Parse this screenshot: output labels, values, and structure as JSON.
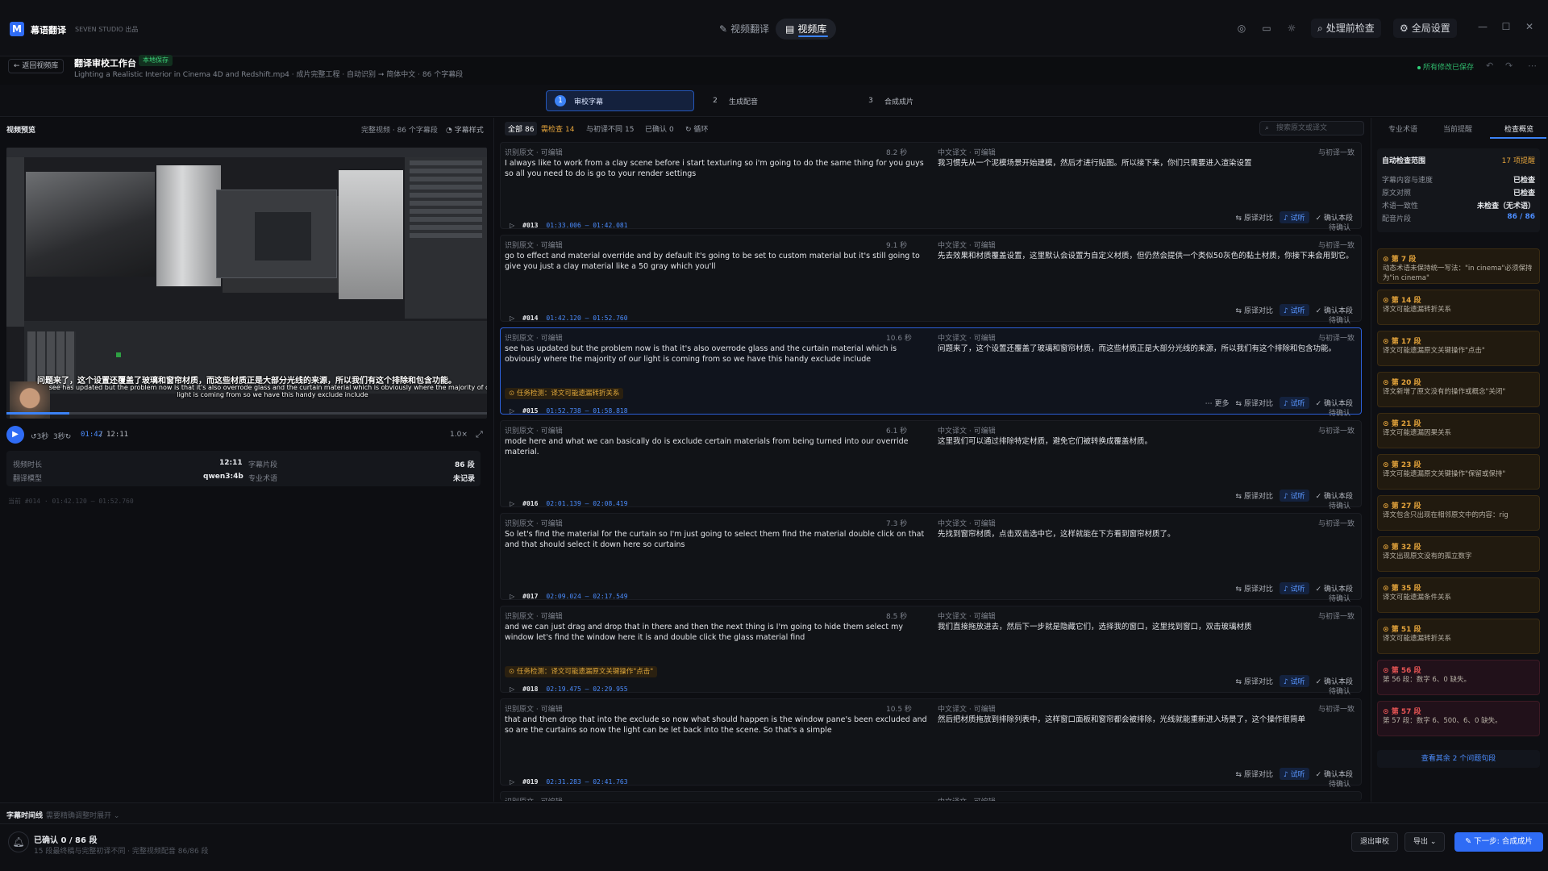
{
  "app": {
    "name": "幕语翻译",
    "subtitle": "SEVEN STUDIO 出品",
    "logo": "M"
  },
  "nav": {
    "tabs": [
      {
        "icon": "translate-icon",
        "label": "视频翻译"
      },
      {
        "icon": "library-icon",
        "label": "视频库"
      }
    ]
  },
  "toolbar": {
    "precheck": "处理前检查",
    "settings": "全局设置"
  },
  "subheader": {
    "back": "返回视频库",
    "title": "翻译审校工作台",
    "badge": "本地保存",
    "file_line": "Lighting a Realistic Interior in Cinema 4D and Redshift.mp4 · 成片完整工程 · 自动识别 ➞ 简体中文 · 86 个字幕段",
    "saved_status": "所有修改已保存"
  },
  "steps": [
    {
      "num": "1",
      "label": "审校字幕"
    },
    {
      "num": "2",
      "label": "生成配音"
    },
    {
      "num": "3",
      "label": "合成成片"
    }
  ],
  "preview": {
    "title": "视频预览",
    "meta": "完整视频 · 86 个字幕段",
    "style_btn": "字幕样式",
    "subtitle_zh": "问题来了，这个设置还覆盖了玻璃和窗帘材质，而这些材质正是大部分光线的来源，所以我们有这个排除和包含功能。",
    "subtitle_en": "see has updated but the problem now is that it's also overrode glass and the curtain material which is obviously where the majority of our light is coming from so we have this handy exclude include",
    "progress": 0.1307,
    "back3": "3秒",
    "fwd3": "3秒",
    "current_time": "01:42",
    "separator": "/",
    "total_time": "12:11",
    "speed": "1.0×"
  },
  "info": {
    "duration_label": "视频时长",
    "duration": "12:11",
    "segments_label": "字幕片段",
    "segments": "86 段",
    "model_label": "翻译模型",
    "model": "qwen3:4b",
    "terms_label": "专业术语",
    "terms": "未记录"
  },
  "current_seg": "当前 #014 · 01:42.120 – 01:52.760",
  "filters": [
    {
      "label": "全部",
      "count": "86",
      "state": "active"
    },
    {
      "label": "需检查",
      "count": "14",
      "state": "warn"
    },
    {
      "label": "与初译不同",
      "count": "15",
      "state": "normal"
    },
    {
      "label": "已确认",
      "count": "0",
      "state": "normal"
    },
    {
      "label": "循环",
      "count": "",
      "state": "normal"
    }
  ],
  "search_placeholder": "搜索原文或译文",
  "labels": {
    "src": "识别原文 · 可编辑",
    "tr": "中文译文 · 可编辑",
    "compare": "原译对比",
    "try": "试听",
    "confirm": "确认本段",
    "more": "更多"
  },
  "segments": [
    {
      "id": "",
      "time": "",
      "state": "",
      "dur": "8.2 秒",
      "flag": "与初译一致",
      "src": "I always like to work from a clay scene before i start texturing so i'm going to do the same thing for you guys so all you need to do is go to your render settings",
      "tr": "我习惯先从一个泥模场景开始建模，然后才进行贴图。所以接下来，你们只需要进入渲染设置",
      "warn": ""
    },
    {
      "id": "#013",
      "time": "01:33.006 – 01:42.081",
      "state": "待确认",
      "dur": "9.1 秒",
      "flag": "与初译一致",
      "src": "go to effect and material override and by default it's going to be set to custom material but it's still going to give you just a clay material like a 50 gray which you'll",
      "tr": "先去效果和材质覆盖设置，这里默认会设置为自定义材质，但仍然会提供一个类似50灰色的黏土材质，你接下来会用到它。",
      "warn": ""
    },
    {
      "id": "#014",
      "time": "01:42.120 – 01:52.760",
      "state": "待确认",
      "dur": "10.6 秒",
      "flag": "与初译一致",
      "src": "see has updated but the problem now is that it's also overrode glass and the curtain material which is obviously where the majority of our light is coming from so we have this handy exclude include",
      "tr": "问题来了，这个设置还覆盖了玻璃和窗帘材质，而这些材质正是大部分光线的来源，所以我们有这个排除和包含功能。",
      "warn": "任务检测：译文可能遗漏转折关系"
    },
    {
      "id": "#015",
      "time": "01:52.738 – 01:58.818",
      "state": "待确认",
      "dur": "6.1 秒",
      "flag": "与初译一致",
      "src": "mode here and what we can basically do is exclude certain materials from being turned into our override material.",
      "tr": "这里我们可以通过排除特定材质，避免它们被转换成覆盖材质。",
      "warn": ""
    },
    {
      "id": "#016",
      "time": "02:01.139 – 02:08.419",
      "state": "待确认",
      "dur": "7.3 秒",
      "flag": "与初译一致",
      "src": "So let's find the material for the curtain so I'm just going to select them find the material double click on that and that should select it down here so curtains",
      "tr": "先找到窗帘材质，点击双击选中它，这样就能在下方看到窗帘材质了。",
      "warn": ""
    },
    {
      "id": "#017",
      "time": "02:09.024 – 02:17.549",
      "state": "待确认",
      "dur": "8.5 秒",
      "flag": "与初译一致",
      "src": "and we can just drag and drop that in there and then the next thing is I'm going to hide them select my window let's find the window here it is and double click the glass material find",
      "tr": "我们直接拖放进去，然后下一步就是隐藏它们，选择我的窗口，这里找到窗口，双击玻璃材质",
      "warn": "任务检测：译文可能遗漏原文关键操作\"点击\""
    },
    {
      "id": "#018",
      "time": "02:19.475 – 02:29.955",
      "state": "待确认",
      "dur": "10.5 秒",
      "flag": "与初译一致",
      "src": "that and then drop that into the exclude so now what should happen is the window pane's been excluded and so are the curtains so now the light can be let back into the scene. So that's a simple",
      "tr": "然后把材质拖放到排除列表中，这样窗口面板和窗帘都会被排除，光线就能重新进入场景了，这个操作很简单",
      "warn": ""
    },
    {
      "id": "#019",
      "time": "02:31.283 – 02:41.763",
      "state": "待确认",
      "dur": "",
      "flag": "",
      "src": "",
      "tr": "",
      "warn": ""
    }
  ],
  "right": {
    "tabs": [
      "专业术语",
      "当前提醒",
      "检查概览"
    ],
    "auto_title": "自动检查范围",
    "auto_count": "17 项提醒",
    "rows": [
      [
        "字幕内容与速度",
        "已检查"
      ],
      [
        "原文对照",
        "已检查"
      ],
      [
        "术语一致性",
        "未检查（无术语）"
      ],
      [
        "配音片段",
        "86 / 86"
      ]
    ],
    "issues": [
      {
        "title": "第 7 段",
        "desc": "动态术语未保持统一写法：\"in cinema\"必须保持为\"in cinema\"",
        "level": "warn"
      },
      {
        "title": "第 14 段",
        "desc": "译文可能遗漏转折关系",
        "level": "warn"
      },
      {
        "title": "第 17 段",
        "desc": "译文可能遗漏原文关键操作\"点击\"",
        "level": "warn"
      },
      {
        "title": "第 20 段",
        "desc": "译文新增了原文没有的操作或概念\"关闭\"",
        "level": "warn"
      },
      {
        "title": "第 21 段",
        "desc": "译文可能遗漏因果关系",
        "level": "warn"
      },
      {
        "title": "第 23 段",
        "desc": "译文可能遗漏原文关键操作\"保留或保持\"",
        "level": "warn"
      },
      {
        "title": "第 27 段",
        "desc": "译文包含只出现在相邻原文中的内容：rig",
        "level": "warn"
      },
      {
        "title": "第 32 段",
        "desc": "译文出现原文没有的孤立数字",
        "level": "warn"
      },
      {
        "title": "第 35 段",
        "desc": "译文可能遗漏条件关系",
        "level": "warn"
      },
      {
        "title": "第 51 段",
        "desc": "译文可能遗漏转折关系",
        "level": "warn"
      },
      {
        "title": "第 56 段",
        "desc": "第 56 段：数字 6、0 缺失。",
        "level": "error"
      },
      {
        "title": "第 57 段",
        "desc": "第 57 段：数字 6、500、6、0 缺失。",
        "level": "error"
      }
    ],
    "view_more": "查看其余 2 个问题句段"
  },
  "timeline": {
    "title": "字幕时间线",
    "hint": "需要精确调整时展开"
  },
  "footer": {
    "status": "已确认 0 / 86 段",
    "sub": "15 段最终稿与完整初译不同 · 完整视频配音 86/86 段",
    "exit": "退出审校",
    "export": "导出",
    "next": "下一步: 合成成片"
  },
  "colors": {
    "accent": "#2f6cf5",
    "warn": "#e3a33b",
    "error": "#e55454",
    "ok": "#2fb86b"
  }
}
